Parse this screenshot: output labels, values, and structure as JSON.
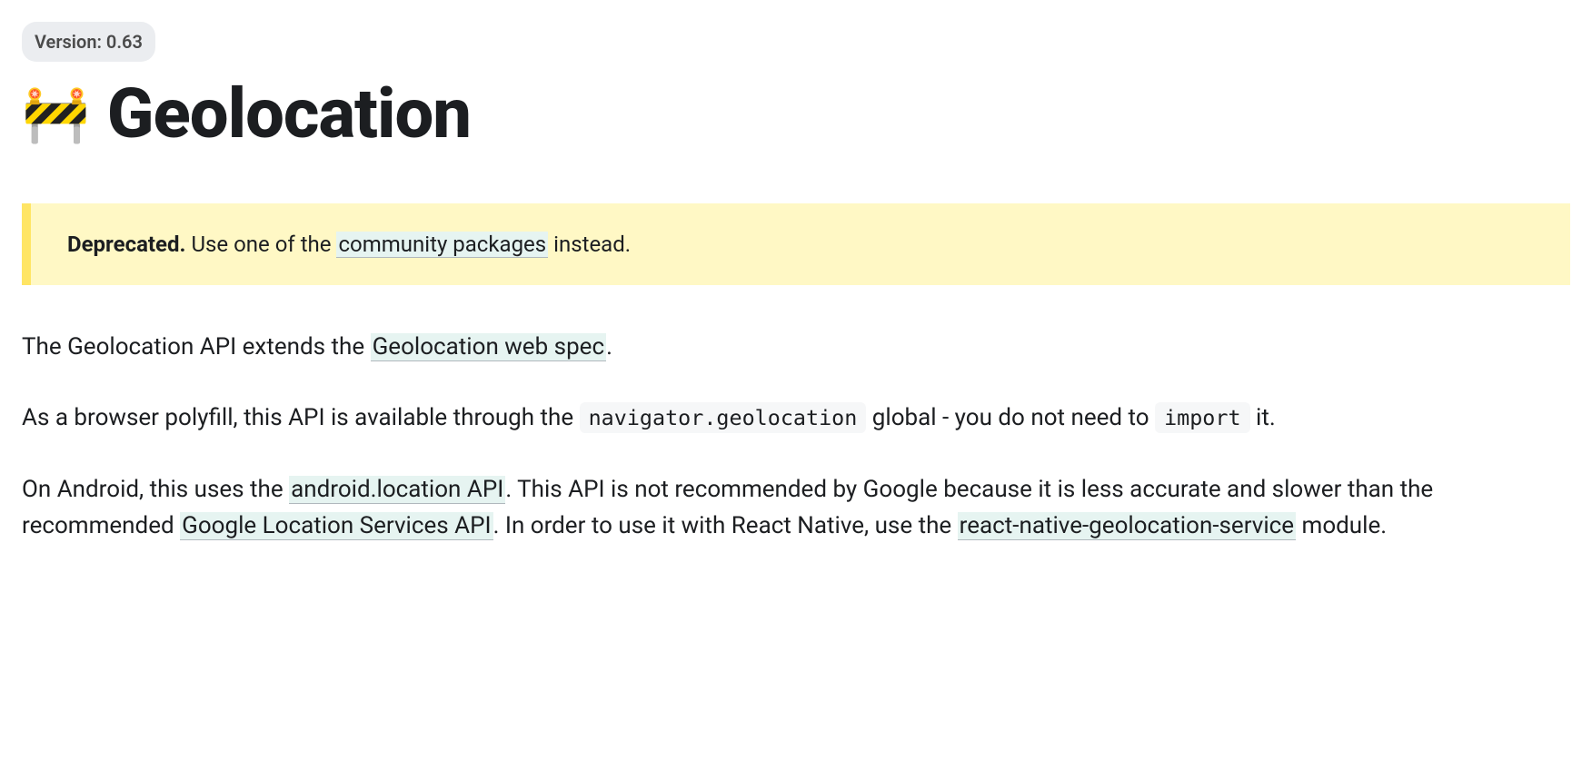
{
  "version_badge": "Version: 0.63",
  "title": {
    "icon": "🚧",
    "text": "Geolocation"
  },
  "deprecated_notice": {
    "strong": "Deprecated.",
    "before_link": " Use one of the ",
    "link": "community packages",
    "after_link": " instead."
  },
  "p1": {
    "before": "The Geolocation API extends the ",
    "link": "Geolocation web spec",
    "after": "."
  },
  "p2": {
    "part1": "As a browser polyfill, this API is available through the ",
    "code1": "navigator.geolocation",
    "part2": " global - you do not need to ",
    "code2": "import",
    "part3": " it."
  },
  "p3": {
    "t1": "On Android, this uses the ",
    "link1": "android.location API",
    "t2": ". This API is not recommended by Google because it is less accurate and slower than the recommended ",
    "link2": "Google Location Services API",
    "t3": ". In order to use it with React Native, use the ",
    "link3": "react-native-geolocation-service",
    "t4": " module."
  }
}
